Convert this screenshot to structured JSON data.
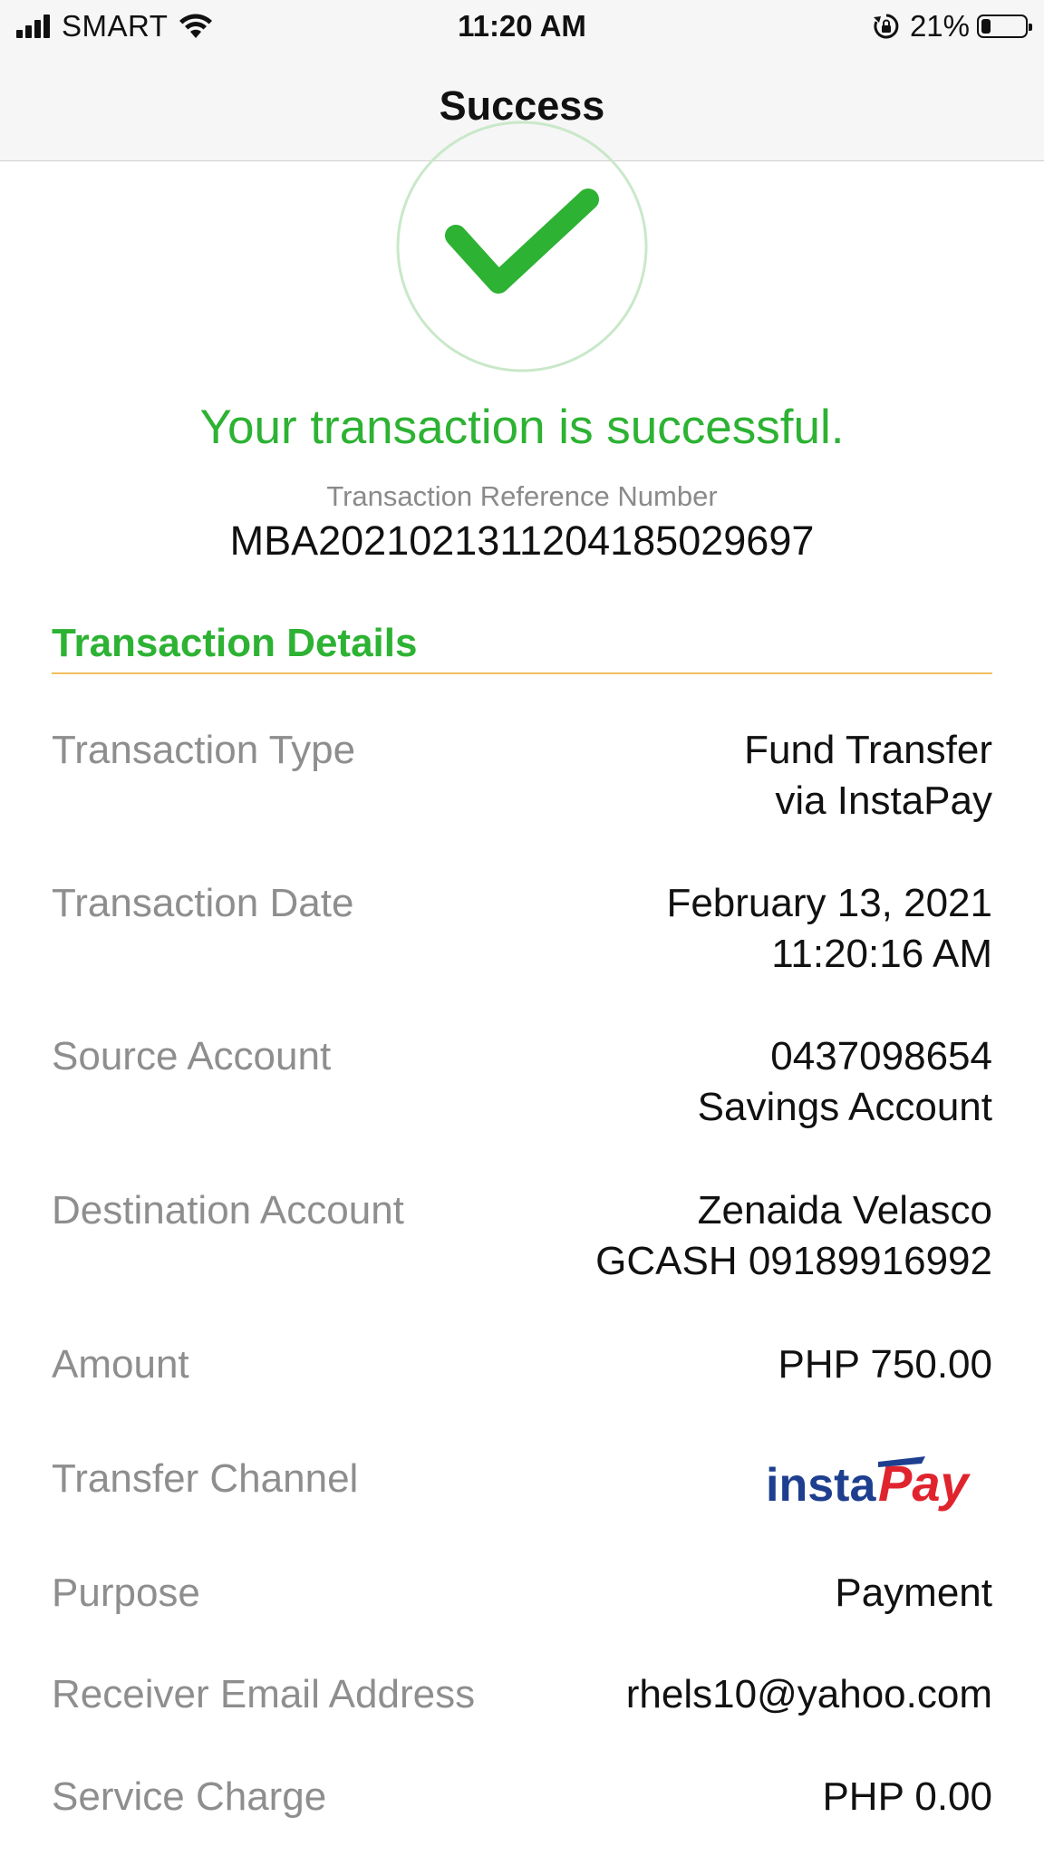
{
  "status_bar": {
    "carrier": "SMART",
    "time": "11:20 AM",
    "battery_percent": "21%",
    "battery_level": 0.21,
    "icons": [
      "signal-icon",
      "wifi-icon",
      "rotation-lock-icon",
      "battery-icon"
    ]
  },
  "nav": {
    "title": "Success"
  },
  "result": {
    "icon": "checkmark-icon",
    "message": "Your transaction is successful.",
    "reference_label": "Transaction Reference Number",
    "reference_number": "MBA20210213112041850 29697"
  },
  "details": {
    "section_title": "Transaction Details",
    "rows": [
      {
        "label": "Transaction Type",
        "value_line1": "Fund Transfer",
        "value_line2": "via InstaPay"
      },
      {
        "label": "Transaction Date",
        "value_line1": "February 13, 2021",
        "value_line2": "11:20:16 AM"
      },
      {
        "label": "Source Account",
        "value_line1": "0437098654",
        "value_line2": "Savings Account"
      },
      {
        "label": "Destination Account",
        "value_line1": "Zenaida Velasco",
        "value_line2": "GCASH 09189916992"
      },
      {
        "label": "Amount",
        "value_line1": "PHP 750.00"
      },
      {
        "label": "Transfer Channel",
        "logo_text": "instaPay"
      },
      {
        "label": "Purpose",
        "value_line1": "Payment"
      },
      {
        "label": "Receiver Email Address",
        "value_line1": "rhels10@yahoo.com"
      },
      {
        "label": "Service Charge",
        "value_line1": "PHP 0.00"
      }
    ]
  },
  "colors": {
    "success_green": "#2db233",
    "divider_orange": "#f2bf5e",
    "label_gray": "#8e8e8e",
    "instapay_blue": "#1e3f8f",
    "instapay_red": "#e0242e"
  }
}
